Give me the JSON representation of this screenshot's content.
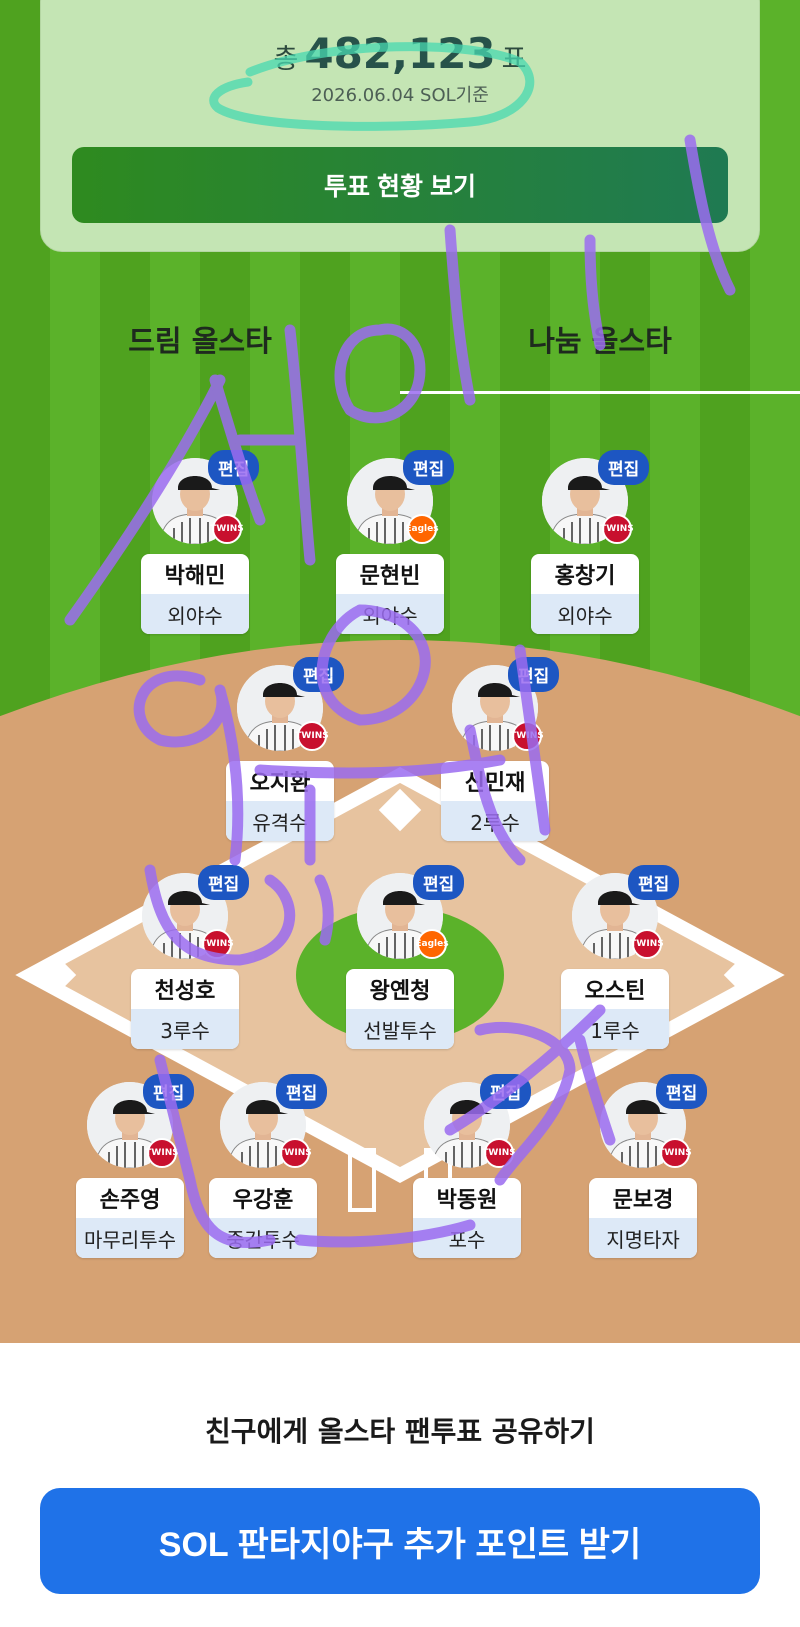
{
  "summary": {
    "total_prefix": "총",
    "total_votes": "482,123",
    "total_suffix": "표",
    "date_note": "2026.06.04 SOL기준",
    "vote_status_button": "투표 현황 보기"
  },
  "tabs": [
    {
      "label": "드림 올스타",
      "selected": false
    },
    {
      "label": "나눔 올스타",
      "selected": true
    }
  ],
  "edit_label": "편집",
  "players": [
    {
      "name": "박해민",
      "position": "외야수",
      "team": "twins"
    },
    {
      "name": "문현빈",
      "position": "외야수",
      "team": "eagles"
    },
    {
      "name": "홍창기",
      "position": "외야수",
      "team": "twins"
    },
    {
      "name": "오지환",
      "position": "유격수",
      "team": "twins"
    },
    {
      "name": "신민재",
      "position": "2루수",
      "team": "twins"
    },
    {
      "name": "천성호",
      "position": "3루수",
      "team": "twins"
    },
    {
      "name": "왕옌청",
      "position": "선발투수",
      "team": "eagles"
    },
    {
      "name": "오스틴",
      "position": "1루수",
      "team": "twins"
    },
    {
      "name": "손주영",
      "position": "마무리투수",
      "team": "twins"
    },
    {
      "name": "우강훈",
      "position": "중간투수",
      "team": "twins"
    },
    {
      "name": "박동원",
      "position": "포수",
      "team": "twins"
    },
    {
      "name": "문보경",
      "position": "지명타자",
      "team": "twins"
    }
  ],
  "team_logos": {
    "twins": "TWINS",
    "eagles": "Eagles"
  },
  "share_text": "친구에게 올스타 팬투표 공유하기",
  "points_button": "SOL 판타지야구 추가 포인트 받기",
  "colors": {
    "grass": "#5bb22a",
    "infield_dirt": "#d6a273",
    "edit_badge": "#1d56c2",
    "points_button": "#1f72e8",
    "scribble": "#9b6cf0",
    "highlight": "#48d8b0"
  }
}
